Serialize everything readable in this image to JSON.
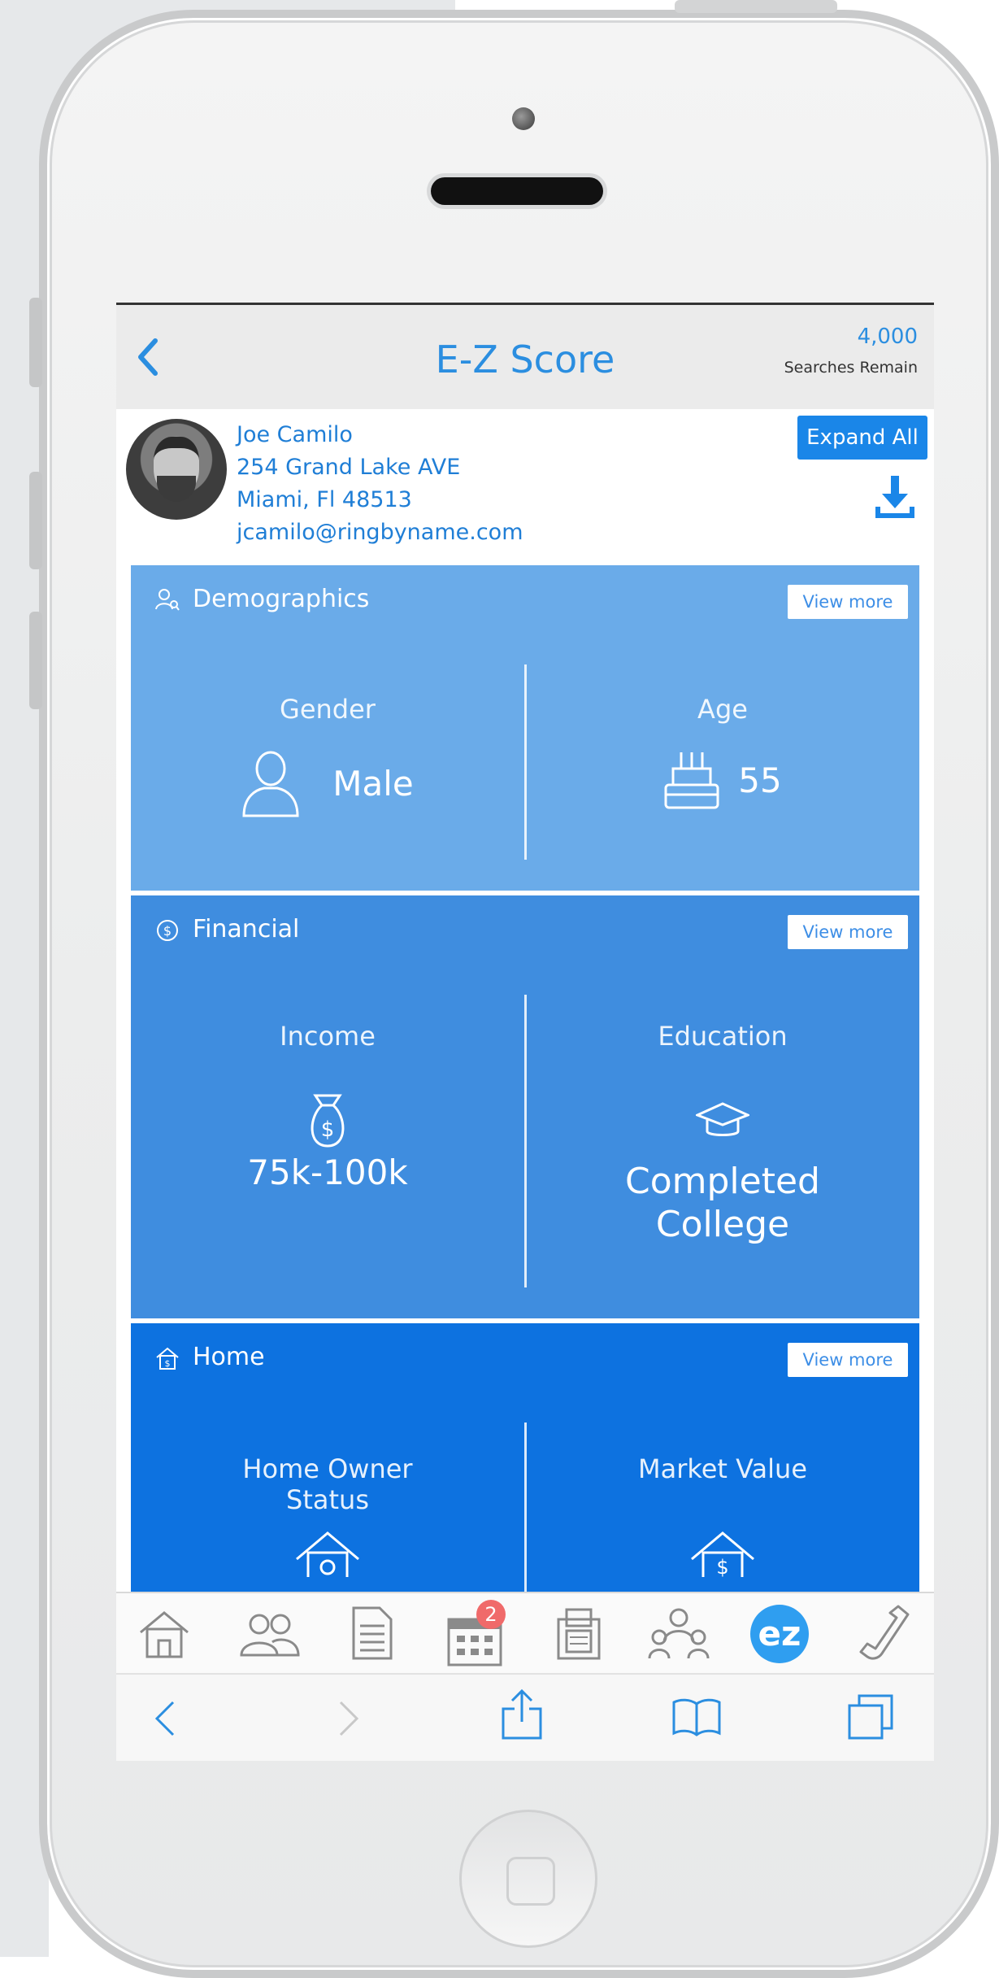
{
  "header": {
    "title": "E-Z Score",
    "search_count": "4,000",
    "search_label": "Searches Remain"
  },
  "profile": {
    "name": "Joe Camilo",
    "street": "254 Grand Lake AVE",
    "city": "Miami, Fl 48513",
    "email": "jcamilo@ringbyname.com",
    "expand_label": "Expand All"
  },
  "sections": {
    "demographics": {
      "title": "Demographics",
      "view_more": "View more",
      "color": "#6aabe9",
      "left": {
        "label": "Gender",
        "value": "Male",
        "icon": "person-icon"
      },
      "right": {
        "label": "Age",
        "value": "55",
        "icon": "birthday-cake-icon"
      }
    },
    "financial": {
      "title": "Financial",
      "view_more": "View more",
      "color": "#3f8ddf",
      "left": {
        "label": "Income",
        "value": "75k-100k",
        "icon": "money-bag-icon"
      },
      "right": {
        "label": "Education",
        "value_line1": "Completed",
        "value_line2": "College",
        "icon": "graduation-cap-icon"
      }
    },
    "home": {
      "title": "Home",
      "view_more": "View more",
      "color": "#0d72e0",
      "left": {
        "label_line1": "Home Owner",
        "label_line2": "Status",
        "icon": "house-icon"
      },
      "right": {
        "label": "Market Value",
        "icon": "house-dollar-icon"
      }
    }
  },
  "tab_bar": {
    "items": [
      "home-icon",
      "contacts-icon",
      "document-icon",
      "calendar-icon",
      "fax-icon",
      "team-icon",
      "ez-icon",
      "phone-icon"
    ],
    "calendar_badge": "2",
    "ez_label": "ez"
  },
  "browser_bar": {
    "items": [
      "back-icon",
      "forward-icon",
      "share-icon",
      "bookmarks-icon",
      "tabs-icon"
    ]
  }
}
